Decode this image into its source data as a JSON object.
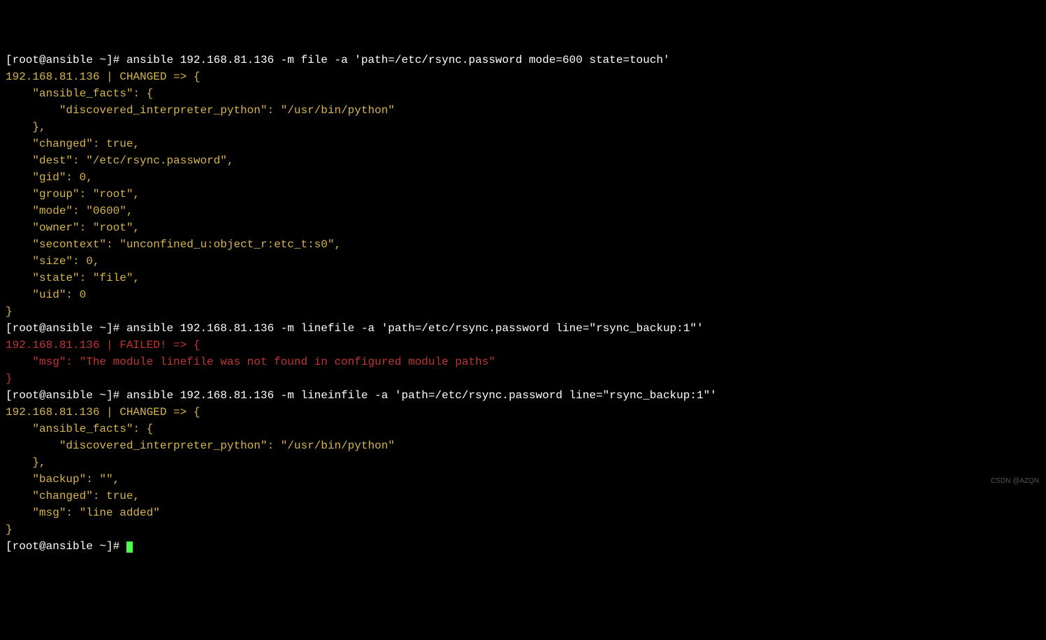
{
  "lines": [
    {
      "cls": "prompt",
      "text": "[root@ansible ~]# ansible 192.168.81.136 -m file -a 'path=/etc/rsync.password mode=600 state=touch'"
    },
    {
      "cls": "yellow",
      "text": "192.168.81.136 | CHANGED => {"
    },
    {
      "cls": "yellow",
      "text": "    \"ansible_facts\": {"
    },
    {
      "cls": "yellow",
      "text": "        \"discovered_interpreter_python\": \"/usr/bin/python\""
    },
    {
      "cls": "yellow",
      "text": "    },"
    },
    {
      "cls": "yellow",
      "text": "    \"changed\": true,"
    },
    {
      "cls": "yellow",
      "text": "    \"dest\": \"/etc/rsync.password\","
    },
    {
      "cls": "yellow",
      "text": "    \"gid\": 0,"
    },
    {
      "cls": "yellow",
      "text": "    \"group\": \"root\","
    },
    {
      "cls": "yellow",
      "text": "    \"mode\": \"0600\","
    },
    {
      "cls": "yellow",
      "text": "    \"owner\": \"root\","
    },
    {
      "cls": "yellow",
      "text": "    \"secontext\": \"unconfined_u:object_r:etc_t:s0\","
    },
    {
      "cls": "yellow",
      "text": "    \"size\": 0,"
    },
    {
      "cls": "yellow",
      "text": "    \"state\": \"file\","
    },
    {
      "cls": "yellow",
      "text": "    \"uid\": 0"
    },
    {
      "cls": "yellow",
      "text": "}"
    },
    {
      "cls": "prompt",
      "text": "[root@ansible ~]# ansible 192.168.81.136 -m linefile -a 'path=/etc/rsync.password line=\"rsync_backup:1\"'"
    },
    {
      "cls": "red",
      "text": "192.168.81.136 | FAILED! => {"
    },
    {
      "cls": "red",
      "text": "    \"msg\": \"The module linefile was not found in configured module paths\""
    },
    {
      "cls": "red",
      "text": "}"
    },
    {
      "cls": "prompt",
      "text": "[root@ansible ~]# ansible 192.168.81.136 -m lineinfile -a 'path=/etc/rsync.password line=\"rsync_backup:1\"'"
    },
    {
      "cls": "yellow",
      "text": "192.168.81.136 | CHANGED => {"
    },
    {
      "cls": "yellow",
      "text": "    \"ansible_facts\": {"
    },
    {
      "cls": "yellow",
      "text": "        \"discovered_interpreter_python\": \"/usr/bin/python\""
    },
    {
      "cls": "yellow",
      "text": "    },"
    },
    {
      "cls": "yellow",
      "text": "    \"backup\": \"\","
    },
    {
      "cls": "yellow",
      "text": "    \"changed\": true,"
    },
    {
      "cls": "yellow",
      "text": "    \"msg\": \"line added\""
    },
    {
      "cls": "yellow",
      "text": "}"
    }
  ],
  "final_prompt": "[root@ansible ~]# ",
  "watermark": "CSDN @AZQN"
}
